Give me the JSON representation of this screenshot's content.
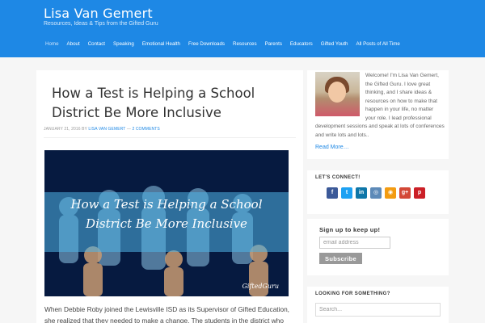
{
  "site": {
    "title": "Lisa Van Gemert",
    "description": "Resources, Ideas & Tips from the Gifted Guru"
  },
  "nav": [
    {
      "label": "Home",
      "active": true
    },
    {
      "label": "About"
    },
    {
      "label": "Contact"
    },
    {
      "label": "Speaking"
    },
    {
      "label": "Emotional Health"
    },
    {
      "label": "Free Downloads"
    },
    {
      "label": "Resources"
    },
    {
      "label": "Parents"
    },
    {
      "label": "Educators"
    },
    {
      "label": "Gifted Youth"
    },
    {
      "label": "All Posts of All Time"
    }
  ],
  "post": {
    "title": "How a Test is Helping a School District Be More Inclusive",
    "date": "JANUARY 21, 2016",
    "by": "BY",
    "author": "LISA VAN GEMERT",
    "sep": "—",
    "comments": "2 COMMENTS",
    "image_line1": "How a Test is Helping a School",
    "image_line2": "District Be More Inclusive",
    "image_signature": "GiftedGuru",
    "excerpt": "When Debbie Roby joined the Lewisville ISD as its Supervisor of Gifted Education, she realized that they needed to make a change. The students in the district who were being"
  },
  "sidebar": {
    "about": {
      "text": "Welcome! I'm Lisa Van Gemert, the Gifted Guru. I love great thinking, and I share ideas & resources on how to make that happen in your life, no matter your role. I lead professional development sessions and speak at lots of conferences and write lots and lots..",
      "read_more": "Read More…"
    },
    "connect": {
      "heading": "LET'S CONNECT!",
      "icons": [
        {
          "name": "facebook-icon",
          "glyph": "f",
          "color": "#3b5998"
        },
        {
          "name": "twitter-icon",
          "glyph": "t",
          "color": "#1da1f2"
        },
        {
          "name": "linkedin-icon",
          "glyph": "in",
          "color": "#0e76a8"
        },
        {
          "name": "instagram-icon",
          "glyph": "◎",
          "color": "#5d8ab8"
        },
        {
          "name": "rss-icon",
          "glyph": "◉",
          "color": "#f39c12"
        },
        {
          "name": "google-plus-icon",
          "glyph": "g+",
          "color": "#d34836"
        },
        {
          "name": "pinterest-icon",
          "glyph": "p",
          "color": "#cb2027"
        }
      ]
    },
    "signup": {
      "label": "Sign up to keep up!",
      "placeholder": "email address",
      "button": "Subscribe"
    },
    "looking": {
      "heading": "LOOKING FOR SOMETHING?",
      "placeholder": "Search..."
    }
  }
}
